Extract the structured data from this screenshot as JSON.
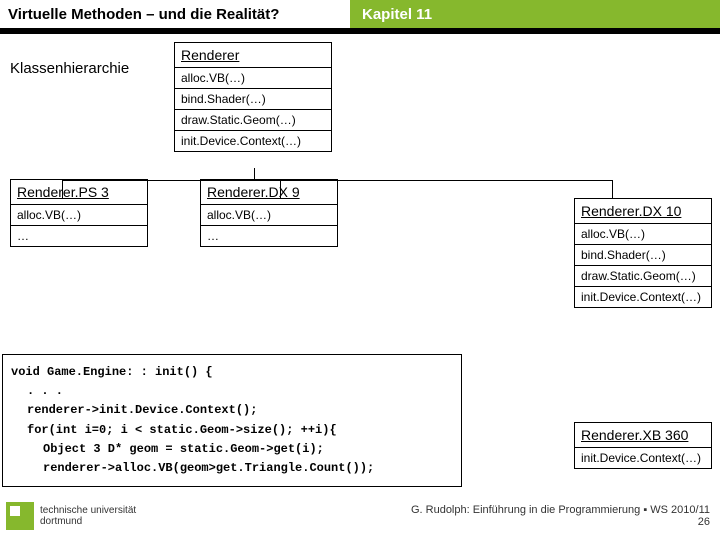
{
  "header": {
    "title_left": "Virtuelle Methoden – und die Realität?",
    "title_right": "Kapitel 11"
  },
  "labels": {
    "klassenhierarchie": "Klassenhierarchie"
  },
  "root_class": {
    "name": "Renderer",
    "methods": [
      "alloc.VB(…)",
      "bind.Shader(…)",
      "draw.Static.Geom(…)",
      "init.Device.Context(…)"
    ]
  },
  "sub_classes": {
    "ps3": {
      "name": "Renderer.PS 3",
      "methods": [
        "alloc.VB(…)",
        "…"
      ]
    },
    "dx9": {
      "name": "Renderer.DX 9",
      "methods": [
        "alloc.VB(…)",
        "…"
      ]
    },
    "dx10": {
      "name": "Renderer.DX 10",
      "methods": [
        "alloc.VB(…)",
        "bind.Shader(…)",
        "draw.Static.Geom(…)",
        "init.Device.Context(…)"
      ]
    },
    "xb360": {
      "name": "Renderer.XB 360",
      "methods": [
        "init.Device.Context(…)"
      ]
    }
  },
  "code": {
    "l0": "void Game.Engine: : init() {",
    "l1": ". . .",
    "l2": "renderer->init.Device.Context();",
    "l3": "for(int i=0; i < static.Geom->size(); ++i){",
    "l4": "Object 3 D* geom = static.Geom->get(i);",
    "l5": "renderer->alloc.VB(geom>get.Triangle.Count());"
  },
  "footer": {
    "uni1": "technische universität",
    "uni2": "dortmund",
    "credit": "G. Rudolph: Einführung in die Programmierung ▪ WS 2010/11",
    "page": "26"
  }
}
